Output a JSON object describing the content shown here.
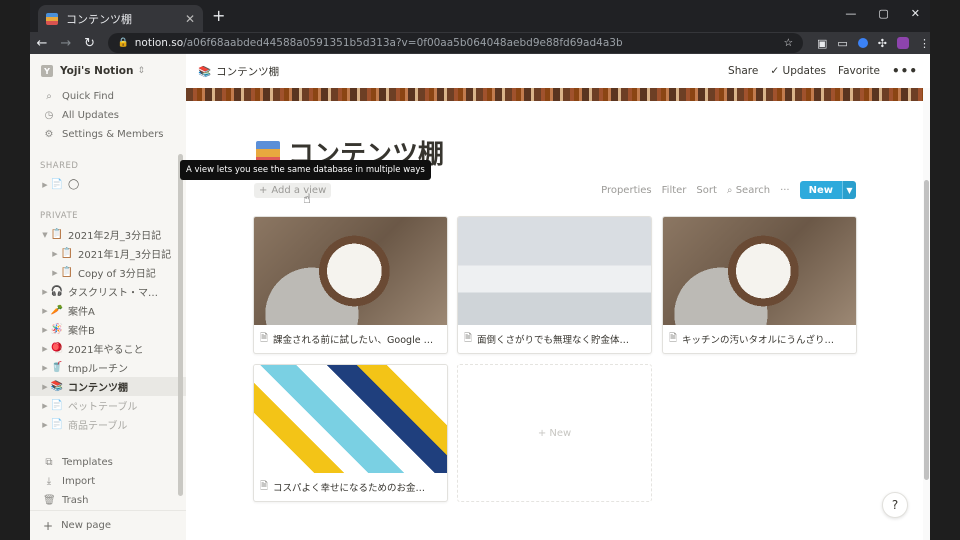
{
  "browser": {
    "tab_title": "コンテンツ棚",
    "tab_close": "✕",
    "new_tab": "+",
    "url_host": "notion.so",
    "url_path": "/a06f68aabded44588a0591351b5d313a?v=0f00aa5b064048aebd9e88fd69ad4a3b",
    "nav_back": "←",
    "nav_forward": "→",
    "reload": "↻",
    "window_controls": [
      "—",
      "▢",
      "✕"
    ]
  },
  "sidebar": {
    "workspace": "Yoji's Notion",
    "workspace_initial": "Y",
    "quick": [
      {
        "icon": "search-icon",
        "label": "Quick Find"
      },
      {
        "icon": "clock-icon",
        "label": "All Updates"
      },
      {
        "icon": "gear-icon",
        "label": "Settings & Members"
      }
    ],
    "shared_label": "SHARED",
    "shared_pages": [
      {
        "label": "◯"
      }
    ],
    "private_label": "PRIVATE",
    "private_pages": [
      {
        "label": "2021年2月_3分日記",
        "indent": 0,
        "icon": "📋"
      },
      {
        "label": "2021年1月_3分日記",
        "indent": 1,
        "icon": "📋"
      },
      {
        "label": "Copy of 3分日記",
        "indent": 1,
        "icon": "📋"
      },
      {
        "label": "タスクリスト・マ…",
        "indent": 0,
        "icon": "🎧"
      },
      {
        "label": "案件A",
        "indent": 0,
        "icon": "🥕"
      },
      {
        "label": "案件B",
        "indent": 0,
        "icon": "🪅"
      },
      {
        "label": "2021年やること",
        "indent": 0,
        "icon": "🪀"
      },
      {
        "label": "tmpルーチン",
        "indent": 0,
        "icon": "🥤"
      },
      {
        "label": "コンテンツ棚",
        "indent": 0,
        "icon": "📚",
        "active": true
      },
      {
        "label": "ペットテーブル",
        "indent": 0,
        "icon": "📄",
        "dim": true
      },
      {
        "label": "商品テーブル",
        "indent": 0,
        "icon": "📄",
        "dim": true
      }
    ],
    "footer": [
      {
        "icon": "templates-icon",
        "label": "Templates"
      },
      {
        "icon": "import-icon",
        "label": "Import"
      },
      {
        "icon": "trash-icon",
        "label": "Trash"
      }
    ],
    "new_page": "New page"
  },
  "topbar": {
    "breadcrumb": "コンテンツ棚",
    "share": "Share",
    "updates": "Updates",
    "favorite": "Favorite",
    "more": "•••"
  },
  "page": {
    "title": "コンテンツ棚",
    "tooltip": "A view lets you see the same database in multiple ways",
    "add_view": "Add a view",
    "properties": "Properties",
    "filter": "Filter",
    "sort": "Sort",
    "search": "Search",
    "more": "···",
    "new": "New",
    "new_card": "+ New",
    "help": "?"
  },
  "cards": [
    {
      "caption": "課金される前に試したい、Google …",
      "image": "yogurt"
    },
    {
      "caption": "面倒くさがりでも無理なく貯金体…",
      "image": "meeting"
    },
    {
      "caption": "キッチンの汚いタオルにうんざり…",
      "image": "yogurt"
    },
    {
      "caption": "コスパよく幸せになるためのお金…",
      "image": "geo"
    }
  ]
}
